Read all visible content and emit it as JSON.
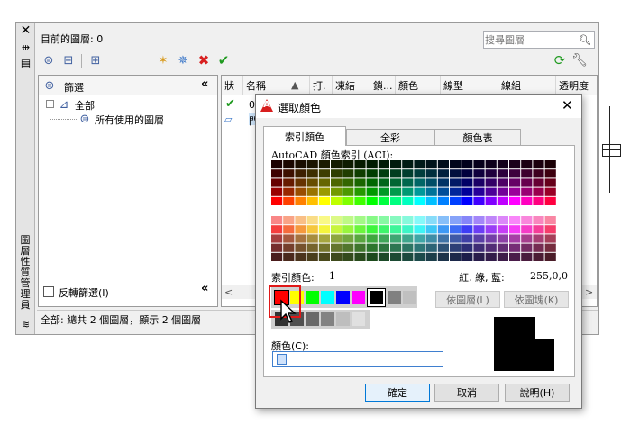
{
  "palette": {
    "current_layer_label": "目前的圖層: 0",
    "search_placeholder": "搜尋圖層",
    "side_title": [
      "圖",
      "層",
      "性",
      "質",
      "管",
      "理",
      "員"
    ],
    "filter_header": "篩選",
    "tree_all": "全部",
    "tree_used": "所有使用的圖層",
    "invert_filter": "反轉篩選(I)",
    "status_text": "全部: 總共 2 個圖層，顯示 2 個圖層",
    "columns": [
      "狀",
      "名稱",
      "▲",
      "打.",
      "凍結",
      "鎖...",
      "顏色",
      "線型",
      "線組",
      "透明度"
    ],
    "row1": {
      "status": "✔",
      "name": "0"
    },
    "row2": {
      "name": "門"
    }
  },
  "dialog": {
    "title": "選取顏色",
    "tabs": [
      "索引顏色",
      "全彩",
      "顏色表"
    ],
    "aci_label": "AutoCAD 顏色索引 (ACI):",
    "index_label": "索引顏色:",
    "index_value": "1",
    "rgb_label": "紅, 綠, 藍:",
    "rgb_value": "255,0,0",
    "bylayer": "依圖層(L)",
    "byblock": "依圖塊(K)",
    "color_label": "顏色(C):",
    "color_value": "",
    "ok": "確定",
    "cancel": "取消",
    "help": "說明(H)"
  },
  "colors": {
    "selected": "#ff0000",
    "highlight": "#e01818"
  }
}
